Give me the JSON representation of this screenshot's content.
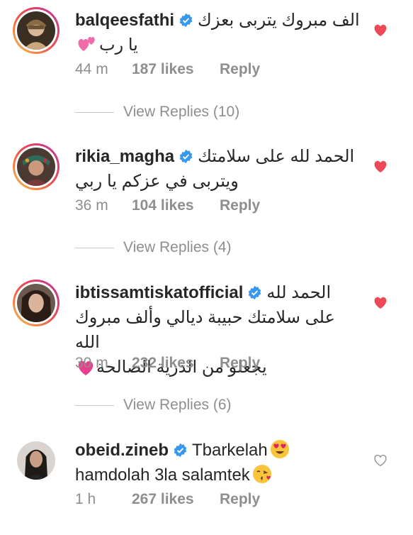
{
  "comments": [
    {
      "username": "balqeesfathi",
      "text_line1": "الف مبروك يتربى بعزك",
      "text_line2": "يا رب",
      "time": "44 m",
      "likes": "187 likes",
      "reply": "Reply",
      "view_replies": "View Replies (10)",
      "liked": true
    },
    {
      "username": "rikia_magha",
      "text_line1": "الحمد لله على سلامتك",
      "text_line2": "ويتربى في عزكم يا ربي",
      "time": "36 m",
      "likes": "104 likes",
      "reply": "Reply",
      "view_replies": "View Replies (4)",
      "liked": true
    },
    {
      "username": "ibtissamtiskatofficial",
      "text_line1": "الحمد لله",
      "text_line2": "على سلامتك حبيبة ديالي وألف مبروك الله",
      "text_line3": "يجعلو من الذرية الصالحة",
      "time": "30 m",
      "likes": "232 likes",
      "reply": "Reply",
      "view_replies": "View Replies (6)",
      "liked": true
    },
    {
      "username": "obeid.zineb",
      "text_line1": "Tbarkelah",
      "text_line2": "hamdolah 3la salamtek",
      "time": "1 h",
      "likes": "267 likes",
      "reply": "Reply",
      "liked": false
    }
  ],
  "colors": {
    "liked_heart": "#ed4956",
    "meta_gray": "#8e8e8e",
    "verified_blue": "#3897f0"
  }
}
